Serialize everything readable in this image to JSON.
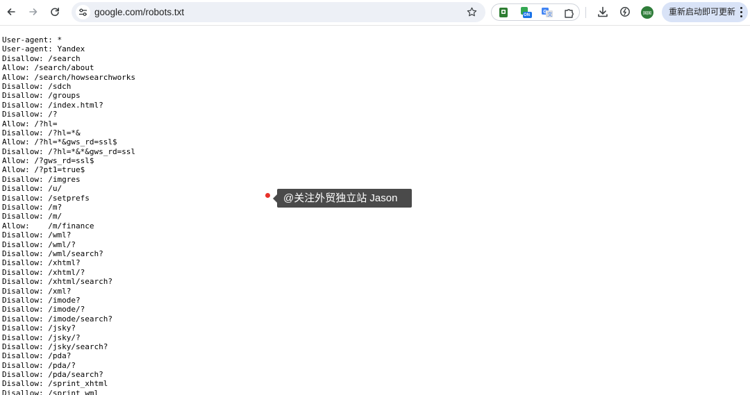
{
  "browser": {
    "url": "google.com/robots.txt",
    "update_button_label": "重新启动即可更新",
    "avatar_text": "国国",
    "extension_badge": "ON"
  },
  "robots_lines": [
    "User-agent: *",
    "User-agent: Yandex",
    "Disallow: /search",
    "Allow: /search/about",
    "Allow: /search/howsearchworks",
    "Disallow: /sdch",
    "Disallow: /groups",
    "Disallow: /index.html?",
    "Disallow: /?",
    "Allow: /?hl=",
    "Disallow: /?hl=*&",
    "Allow: /?hl=*&gws_rd=ssl$",
    "Disallow: /?hl=*&*&gws_rd=ssl",
    "Allow: /?gws_rd=ssl$",
    "Allow: /?pt1=true$",
    "Disallow: /imgres",
    "Disallow: /u/",
    "Disallow: /setprefs",
    "Disallow: /m?",
    "Disallow: /m/",
    "Allow:    /m/finance",
    "Disallow: /wml?",
    "Disallow: /wml/?",
    "Disallow: /wml/search?",
    "Disallow: /xhtml?",
    "Disallow: /xhtml/?",
    "Disallow: /xhtml/search?",
    "Disallow: /xml?",
    "Disallow: /imode?",
    "Disallow: /imode/?",
    "Disallow: /imode/search?",
    "Disallow: /jsky?",
    "Disallow: /jsky/?",
    "Disallow: /jsky/search?",
    "Disallow: /pda?",
    "Disallow: /pda/?",
    "Disallow: /pda/search?",
    "Disallow: /sprint_xhtml",
    "Disallow: /sprint_wml"
  ],
  "overlay": {
    "watermark_text": "@关注外贸独立站 Jason"
  },
  "colors": {
    "omnibox_bg": "#edf0f6",
    "update_button_bg": "#d9e3f7",
    "tooltip_bg": "#4a4a4a",
    "dot_red": "#e8322a",
    "avatar_bg": "#2f7d3a"
  },
  "icons": {
    "back": "arrow-left-icon",
    "forward": "arrow-right-icon",
    "reload": "reload-icon",
    "site_info": "tune-icon",
    "bookmark": "star-icon",
    "extensions": [
      "green-book-extension-icon",
      "on-badge-extension-icon",
      "translate-extension-icon",
      "puzzle-extension-icon"
    ],
    "download": "download-icon",
    "performance": "performance-icon",
    "menu": "more-vert-icon"
  }
}
